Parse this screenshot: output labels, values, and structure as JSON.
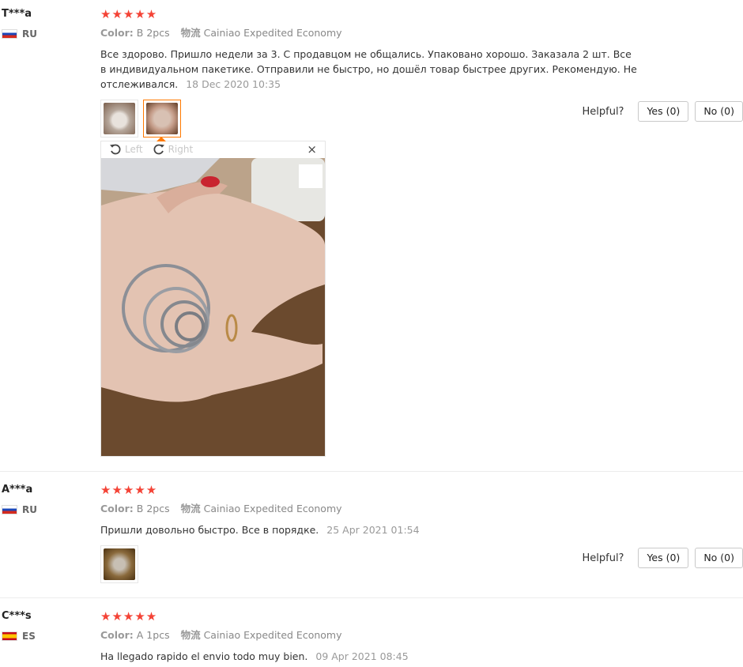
{
  "labels": {
    "color_key": "Color:",
    "shipping_key": "物流",
    "helpful": "Helpful?",
    "yes": "Yes (0)",
    "no": "No (0)",
    "rotate_left": "Left",
    "rotate_right": "Right",
    "close": "×"
  },
  "reviews": [
    {
      "user": "T***a",
      "country": "RU",
      "stars": "★★★★★",
      "color": "B 2pcs",
      "shipping": "Cainiao Expedited Economy",
      "text": "Все здорово. Пришло недели за 3. С продавцом не общались. Упаковано хорошо. Заказала 2 шт. Все в индивидуальном пакетике. Отправили не быстро, но дошёл товар быстрее других. Рекомендую. Не отслеживался.",
      "date": "18 Dec 2020 10:35"
    },
    {
      "user": "A***a",
      "country": "RU",
      "stars": "★★★★★",
      "color": "B 2pcs",
      "shipping": "Cainiao Expedited Economy",
      "text": "Пришли довольно быстро. Все в порядке.",
      "date": "25 Apr 2021 01:54"
    },
    {
      "user": "C***s",
      "country": "ES",
      "stars": "★★★★★",
      "color": "A 1pcs",
      "shipping": "Cainiao Expedited Economy",
      "text": "Ha llegado rapido el envio todo muy bien.",
      "date": "09 Apr 2021 08:45"
    }
  ]
}
